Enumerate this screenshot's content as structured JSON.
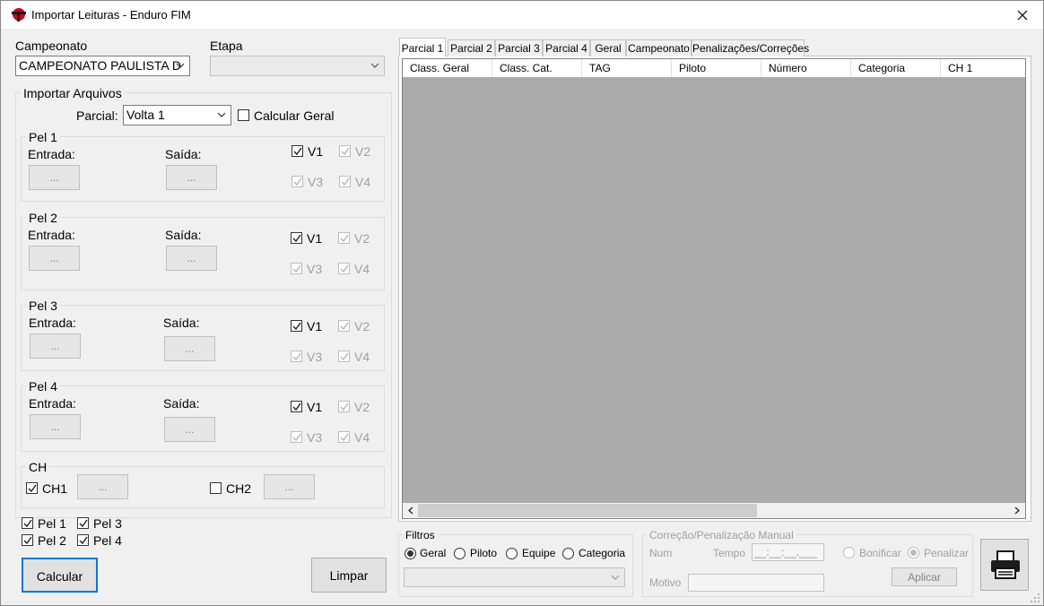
{
  "window": {
    "title": "Importar Leituras - Enduro FIM",
    "close_glyph": "✕"
  },
  "campeonato": {
    "label": "Campeonato",
    "value": "CAMPEONATO PAULISTA D"
  },
  "etapa": {
    "label": "Etapa",
    "value": ""
  },
  "importar": {
    "title": "Importar Arquivos",
    "parcial_label": "Parcial:",
    "parcial_value": "Volta 1",
    "calcular_geral": "Calcular Geral",
    "calcular_geral_checked": false
  },
  "pels": [
    {
      "title": "Pel 1",
      "entrada": "Entrada:",
      "saida": "Saída:",
      "btn": "...",
      "v1": "V1",
      "v2": "V2",
      "v3": "V3",
      "v4": "V4"
    },
    {
      "title": "Pel 2",
      "entrada": "Entrada:",
      "saida": "Saída:",
      "btn": "...",
      "v1": "V1",
      "v2": "V2",
      "v3": "V3",
      "v4": "V4"
    },
    {
      "title": "Pel 3",
      "entrada": "Entrada:",
      "saida": "Saída:",
      "btn": "...",
      "v1": "V1",
      "v2": "V2",
      "v3": "V3",
      "v4": "V4"
    },
    {
      "title": "Pel 4",
      "entrada": "Entrada:",
      "saida": "Saída:",
      "btn": "...",
      "v1": "V1",
      "v2": "V2",
      "v3": "V3",
      "v4": "V4"
    }
  ],
  "ch": {
    "title": "CH",
    "ch1": "CH1",
    "ch2": "CH2",
    "btn": "...",
    "ch1_checked": true,
    "ch2_checked": false
  },
  "pel_checks": {
    "pel1": "Pel 1",
    "pel2": "Pel 2",
    "pel3": "Pel 3",
    "pel4": "Pel 4"
  },
  "buttons": {
    "calcular": "Calcular",
    "limpar": "Limpar"
  },
  "tabs": [
    "Parcial 1",
    "Parcial 2",
    "Parcial 3",
    "Parcial 4",
    "Geral",
    "Campeonato",
    "Penalizações/Correções"
  ],
  "active_tab": "Parcial 1",
  "grid": {
    "columns": [
      "Class. Geral",
      "Class. Cat.",
      "TAG",
      "Piloto",
      "Número",
      "Categoria",
      "CH 1"
    ]
  },
  "filtros": {
    "title": "Filtros",
    "options": [
      "Geral",
      "Piloto",
      "Equipe",
      "Categoria"
    ],
    "selected": "Geral",
    "combo_value": ""
  },
  "correcao": {
    "title": "Correção/Penalização Manual",
    "num": "Num",
    "tempo": "Tempo",
    "tempo_mask": "__:__:__.___",
    "bonificar": "Bonificar",
    "penalizar": "Penalizar",
    "selected": "Penalizar",
    "aplicar": "Aplicar",
    "motivo": "Motivo"
  },
  "colors": {
    "grid_bg": "#ababab",
    "focus_border": "#0078d7",
    "accent_icon": "#e81123"
  },
  "icons": {
    "print": "printer-icon"
  }
}
